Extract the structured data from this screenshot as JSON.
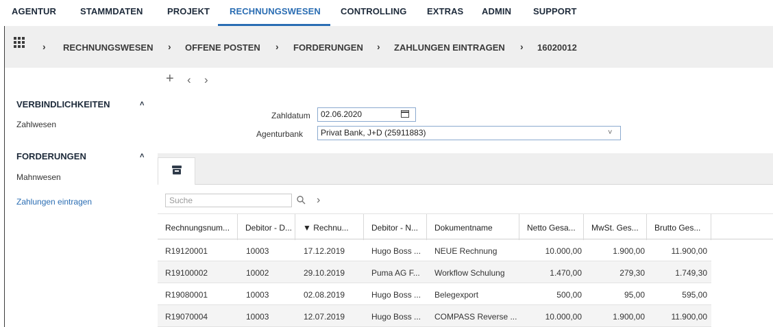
{
  "nav": {
    "items": [
      "AGENTUR",
      "STAMMDATEN",
      "PROJEKT",
      "RECHNUNGSWESEN",
      "CONTROLLING",
      "EXTRAS",
      "ADMIN",
      "SUPPORT"
    ],
    "active": "RECHNUNGSWESEN",
    "accent_color": "#2a6db3"
  },
  "breadcrumb": {
    "items": [
      "RECHNUNGSWESEN",
      "OFFENE POSTEN",
      "FORDERUNGEN",
      "ZAHLUNGEN EINTRAGEN",
      "16020012"
    ],
    "separator": "›"
  },
  "sidebar": {
    "section1": {
      "title": "VERBINDLICHKEITEN",
      "caret": "˄",
      "items": [
        "Zahlwesen"
      ]
    },
    "section2": {
      "title": "FORDERUNGEN",
      "caret": "˄",
      "items": [
        "Mahnwesen",
        "Zahlungen eintragen"
      ]
    }
  },
  "toolbar": {
    "add": "+",
    "prev": "‹",
    "next": "›"
  },
  "form": {
    "zahldatum_label": "Zahldatum",
    "zahldatum_value": "02.06.2020",
    "bank_label": "Agenturbank",
    "bank_value": "Privat Bank, J+D (25911883)"
  },
  "tabs": [
    {
      "icon": "archive-box-icon"
    }
  ],
  "table": {
    "search_placeholder": "Suche",
    "columns": [
      "Rechnungsnum...",
      "Debitor - D...",
      "▼ Rechnu...",
      "Debitor - N...",
      "Dokumentname",
      "Netto Gesa...",
      "MwSt. Ges...",
      "Brutto Ges..."
    ],
    "rows": [
      [
        "R19120001",
        "10003",
        "17.12.2019",
        "Hugo Boss ...",
        "NEUE Rechnung",
        "10.000,00",
        "1.900,00",
        "11.900,00"
      ],
      [
        "R19100002",
        "10002",
        "29.10.2019",
        "Puma AG F...",
        "Workflow Schulung",
        "1.470,00",
        "279,30",
        "1.749,30"
      ],
      [
        "R19080001",
        "10003",
        "02.08.2019",
        "Hugo Boss ...",
        "Belegexport",
        "500,00",
        "95,00",
        "595,00"
      ],
      [
        "R19070004",
        "10003",
        "12.07.2019",
        "Hugo Boss ...",
        "COMPASS Reverse ...",
        "10.000,00",
        "1.900,00",
        "11.900,00"
      ]
    ]
  }
}
